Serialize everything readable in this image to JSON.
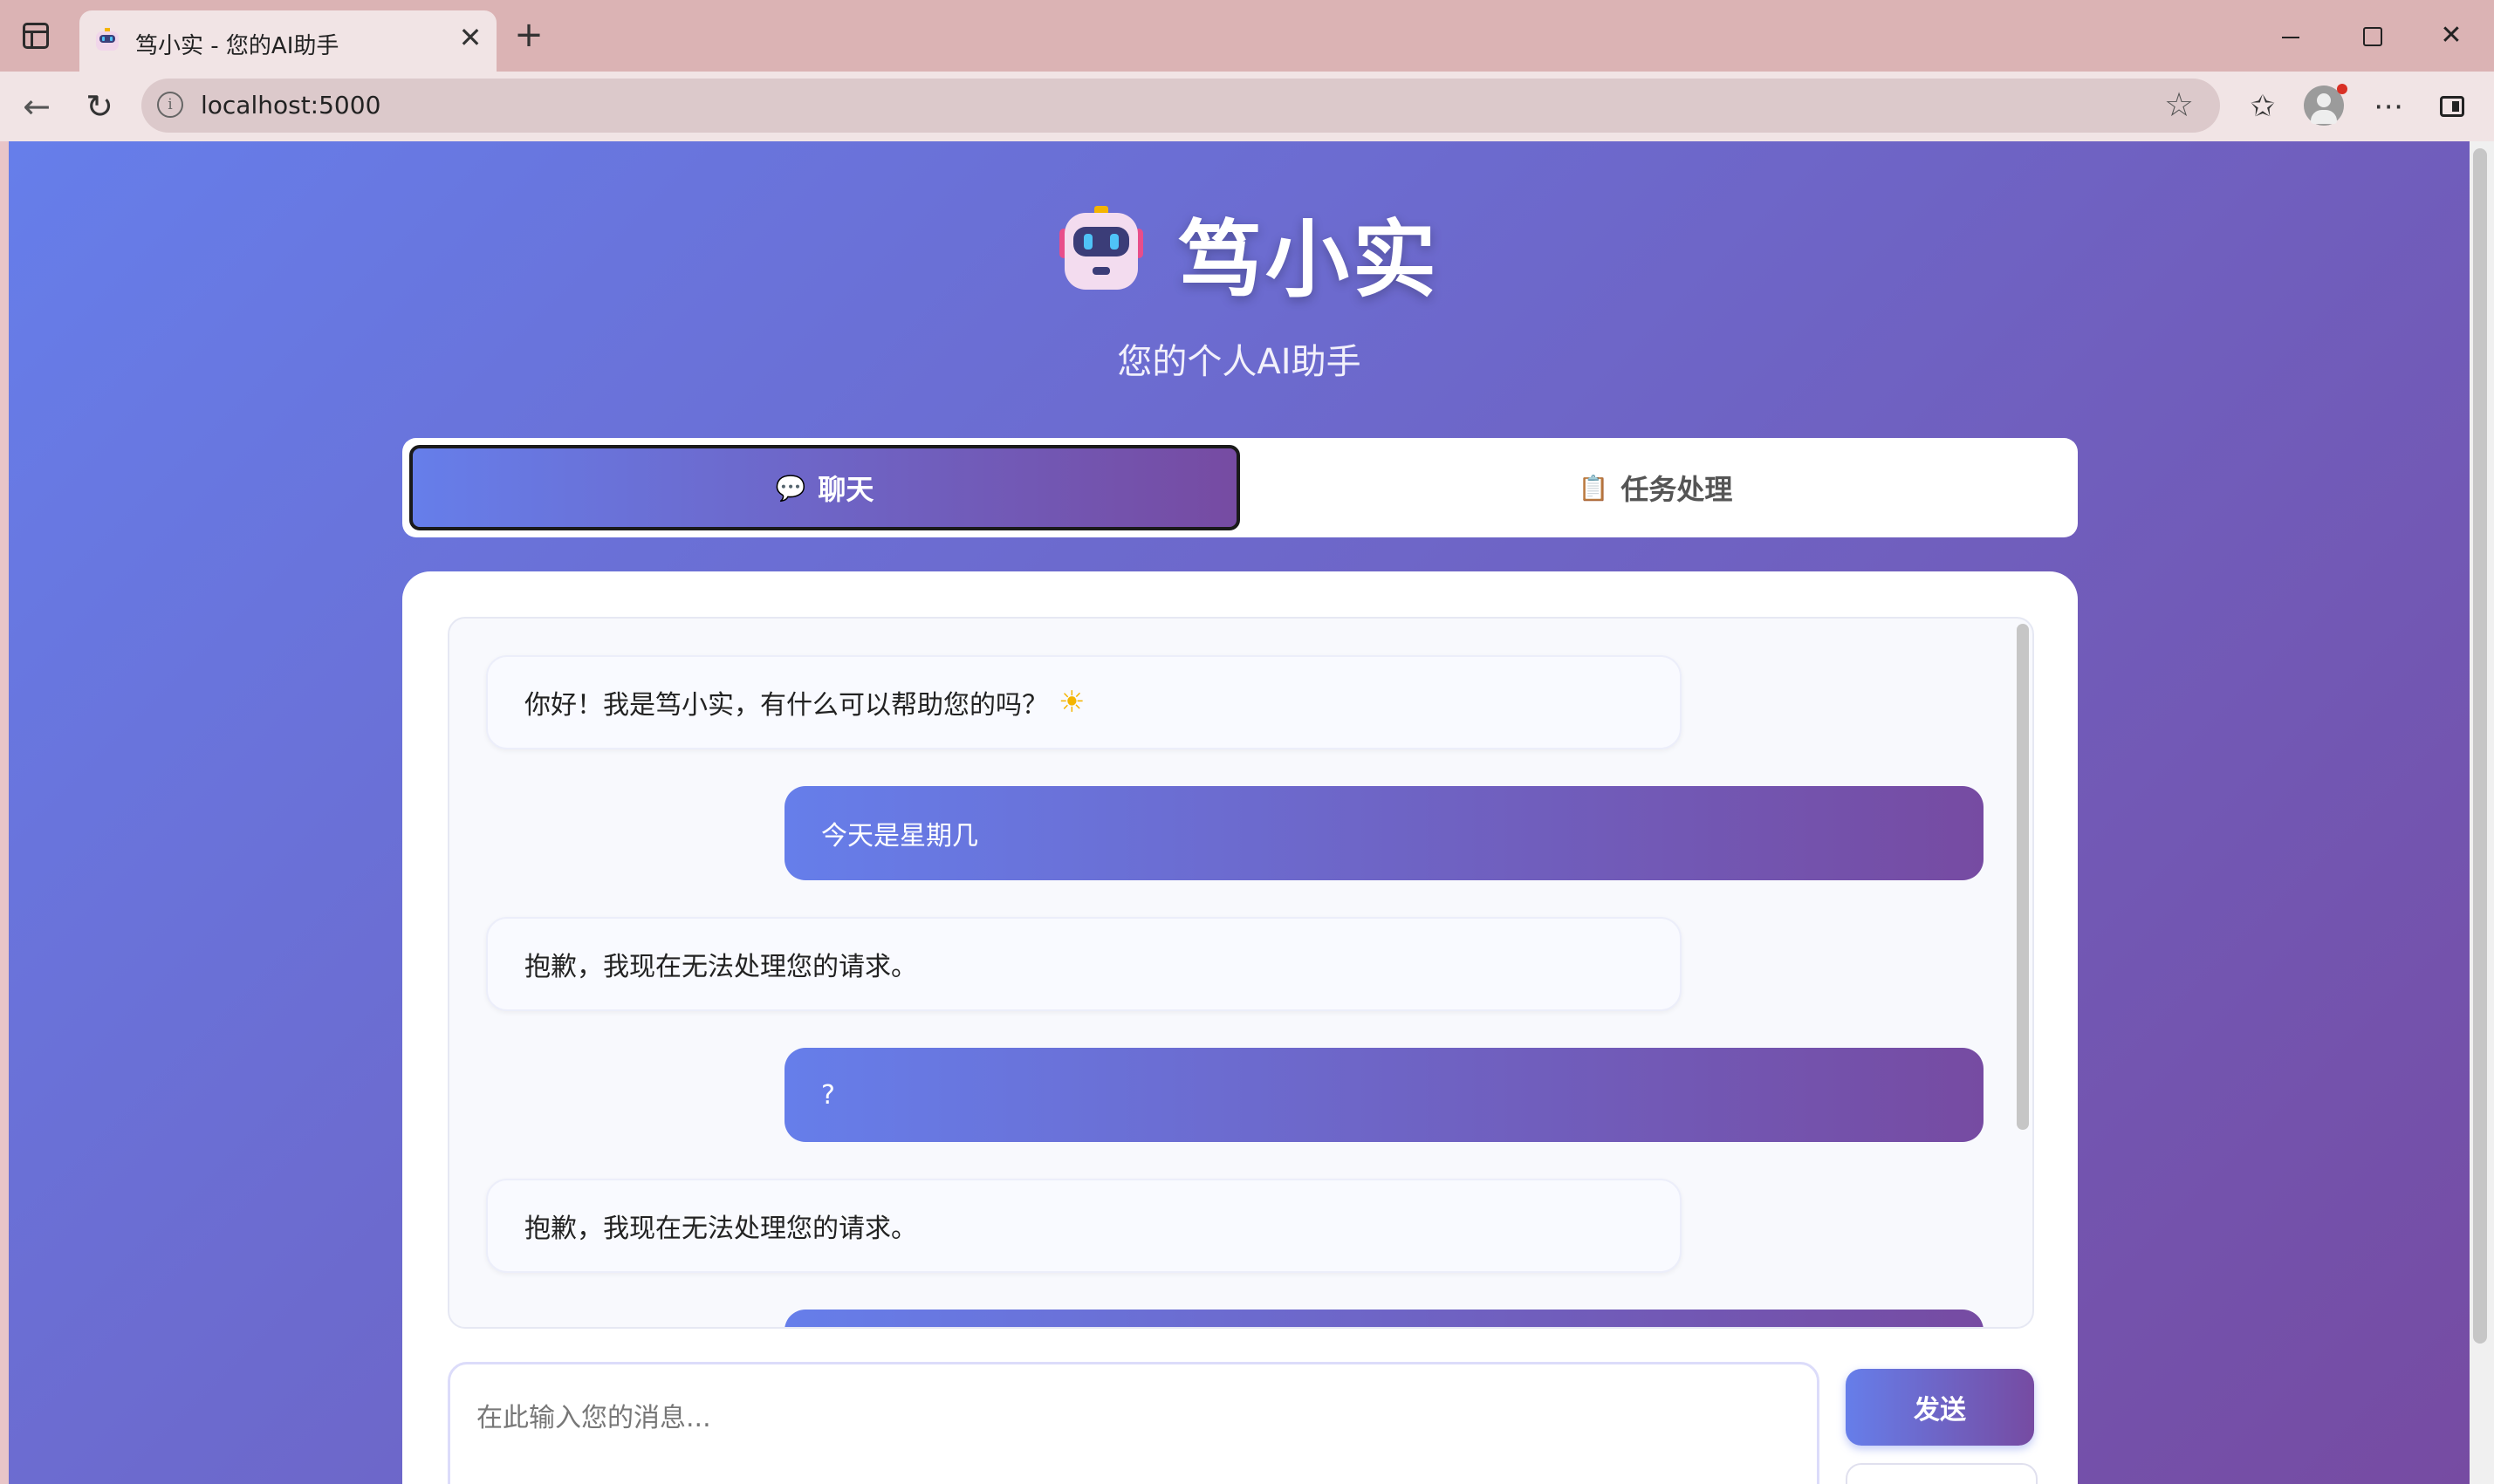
{
  "browser": {
    "tab_title": "笃小实 - 您的AI助手",
    "close_glyph": "✕",
    "new_tab_glyph": "+",
    "url": "localhost:5000",
    "info_glyph": "i",
    "star_glyph": "☆",
    "favorites_glyph": "✩",
    "more_glyph": "⋯",
    "back_glyph": "←",
    "reload_glyph": "↻",
    "window_close_glyph": "✕"
  },
  "header": {
    "title": "笃小实",
    "subtitle": "您的个人AI助手"
  },
  "tabs": [
    {
      "icon": "💬",
      "label": "聊天",
      "active": true
    },
    {
      "icon": "📋",
      "label": "任务处理",
      "active": false
    }
  ],
  "messages": [
    {
      "role": "bot",
      "text": "你好！我是笃小实，有什么可以帮助您的吗？",
      "icon": "☀"
    },
    {
      "role": "user",
      "text": "今天是星期几"
    },
    {
      "role": "bot",
      "text": "抱歉，我现在无法处理您的请求。"
    },
    {
      "role": "user",
      "text": "?"
    },
    {
      "role": "bot",
      "text": "抱歉，我现在无法处理您的请求。"
    }
  ],
  "composer": {
    "placeholder": "在此输入您的消息...",
    "send_label": "发送"
  },
  "colors": {
    "gradient_start": "#667eea",
    "gradient_end": "#764ba2",
    "tab_strip": "#dbb3b4",
    "toolbar": "#f1e4e5"
  }
}
